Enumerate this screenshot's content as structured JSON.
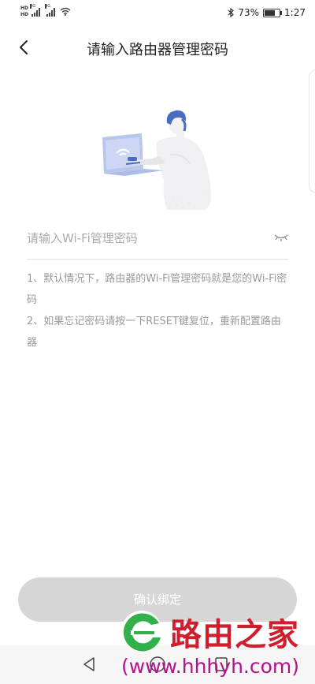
{
  "status_bar": {
    "hd_top": "HD",
    "hd_bottom": "HD",
    "network_1": "4G",
    "network_2": "4G",
    "battery": "73%",
    "battery_level": 0.73,
    "time": "1:27"
  },
  "header": {
    "title": "请输入路由器管理密码"
  },
  "password": {
    "placeholder": "请输入Wi-Fi管理密码"
  },
  "hints": [
    "1、默认情况下，路由器的Wi-Fi管理密码就是您的Wi-Fi密码",
    "2、如果忘记密码请按一下RESET键复位，重新配置路由器"
  ],
  "confirm_label": "确认绑定",
  "watermark": {
    "brand": "路由之家",
    "url": "(www.hhhyh.com)"
  },
  "colors": {
    "button_disabled": "#d6d6d6",
    "hint_text": "#999999",
    "watermark_brand": "#d01e2d",
    "watermark_url": "#b2138a",
    "logo_green": "#32b04a"
  }
}
